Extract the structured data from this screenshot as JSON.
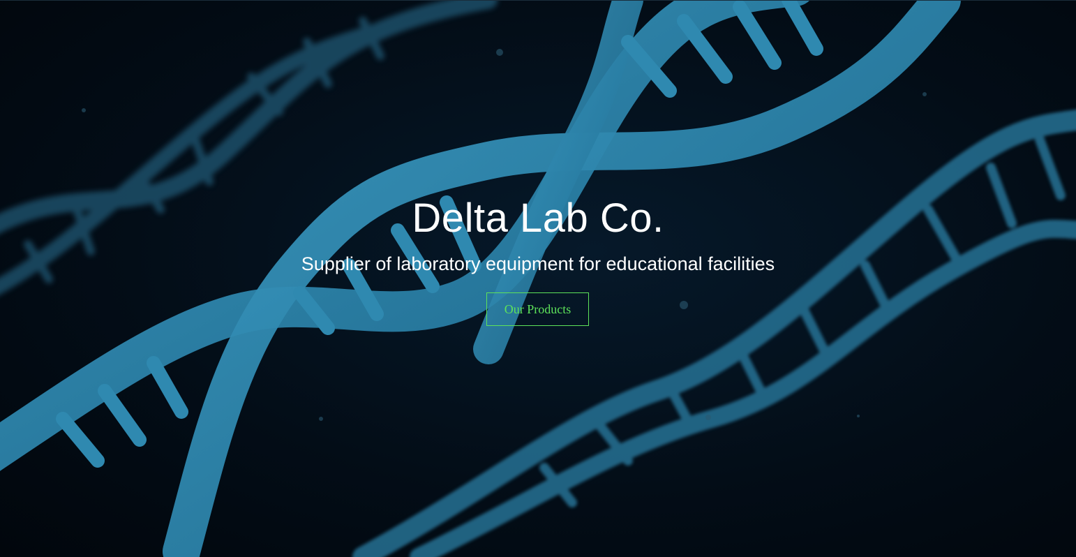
{
  "hero": {
    "title": "Delta Lab Co.",
    "subtitle": "Supplier of laboratory equipment for educational facilities",
    "cta_label": "Our Products",
    "background_image": "dna-double-helix-image"
  },
  "colors": {
    "background": "#020a12",
    "helix": "#2a7fa5",
    "title_text": "#ffffff",
    "cta_accent": "#5ee35a"
  }
}
